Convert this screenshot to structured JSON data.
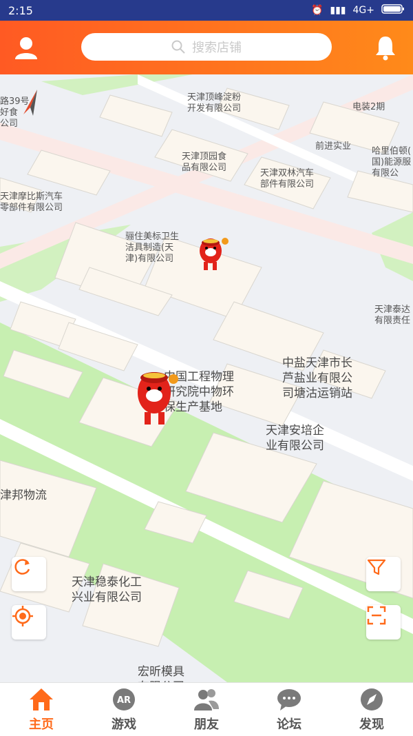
{
  "status_bar": {
    "time": "2:15",
    "network": "4G+"
  },
  "search": {
    "placeholder": "搜索店铺"
  },
  "map_labels": [
    "路39号\n好食\n公司",
    "天津顶峰淀粉\n开发有限公司",
    "电装2期",
    "前进实业",
    "哈里伯顿(\n国)能源服\n有限公",
    "天津顶园食\n品有限公司",
    "天津双林汽车\n部件有限公司",
    "天津摩比斯汽车\n零部件有限公司",
    "骊住美标卫生\n洁具制造(天\n津)有限公司",
    "天津泰达\n有限责任",
    "中国工程物理\n研究院中物环\n保生产基地",
    "中盐天津市长\n芦盐业有限公\n司塘沽运销站",
    "天津安培企\n业有限公司",
    "津邦物流",
    "天津稳泰化工\n兴业有限公司",
    "宏昕模具\n有限公司"
  ],
  "tabs": [
    {
      "label": "主页",
      "icon": "home-icon",
      "active": true
    },
    {
      "label": "游戏",
      "icon": "ar-icon",
      "icon_text": "AR",
      "active": false
    },
    {
      "label": "朋友",
      "icon": "friends-icon",
      "active": false
    },
    {
      "label": "论坛",
      "icon": "forum-icon",
      "active": false
    },
    {
      "label": "发现",
      "icon": "compass-icon",
      "active": false
    }
  ],
  "colors": {
    "accent": "#ff6a1a",
    "header_start": "#ff5a23",
    "header_end": "#ff8a1a",
    "statusbar": "#273a8c",
    "park": "#c7efb1"
  }
}
